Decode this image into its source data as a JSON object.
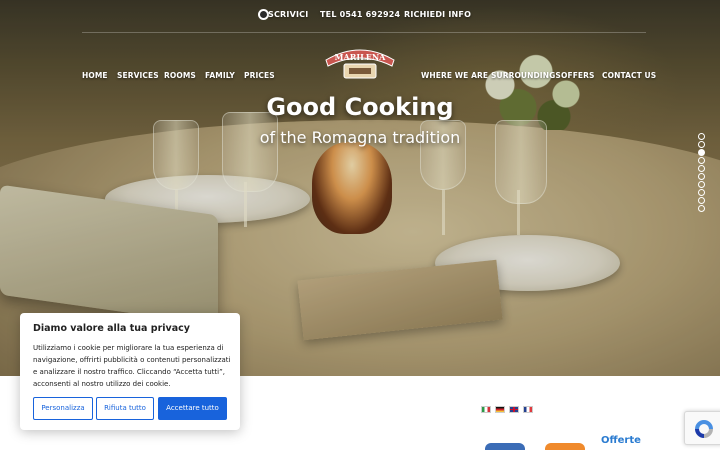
{
  "topbar": {
    "whatsapp_label": "SCRIVICI",
    "phone_label": "TEL 0541 692924",
    "info_label": "RICHIEDI INFO"
  },
  "logo": {
    "text": "MARILENA",
    "icon": "hotel-logo"
  },
  "nav": {
    "left": [
      "HOME",
      "SERVICES",
      "ROOMS",
      "FAMILY",
      "PRICES"
    ],
    "right": [
      "WHERE WE ARE",
      "SURROUNDINGS",
      "OFFERS",
      "CONTACT US"
    ]
  },
  "hero": {
    "title": "Good Cooking",
    "subtitle": "of the Romagna tradition",
    "slides_total": 10,
    "active_slide": 3
  },
  "languages": [
    "it",
    "de",
    "en",
    "fr"
  ],
  "bottom": {
    "offers_label": "Offerte"
  },
  "cookie": {
    "title": "Diamo valore alla tua privacy",
    "text": "Utilizziamo i cookie per migliorare la tua esperienza di navigazione, offrirti pubblicità o contenuti personalizzati e analizzare il nostro traffico. Cliccando “Accetta tutti”, acconsenti al nostro utilizzo dei cookie.",
    "customize_label": "Personalizza",
    "reject_label": "Rifiuta tutto",
    "accept_label": "Accettare tutto"
  },
  "colors": {
    "accent_blue": "#1863dc",
    "offer_blue": "#2a7bd0",
    "orange": "#f08a2c"
  }
}
